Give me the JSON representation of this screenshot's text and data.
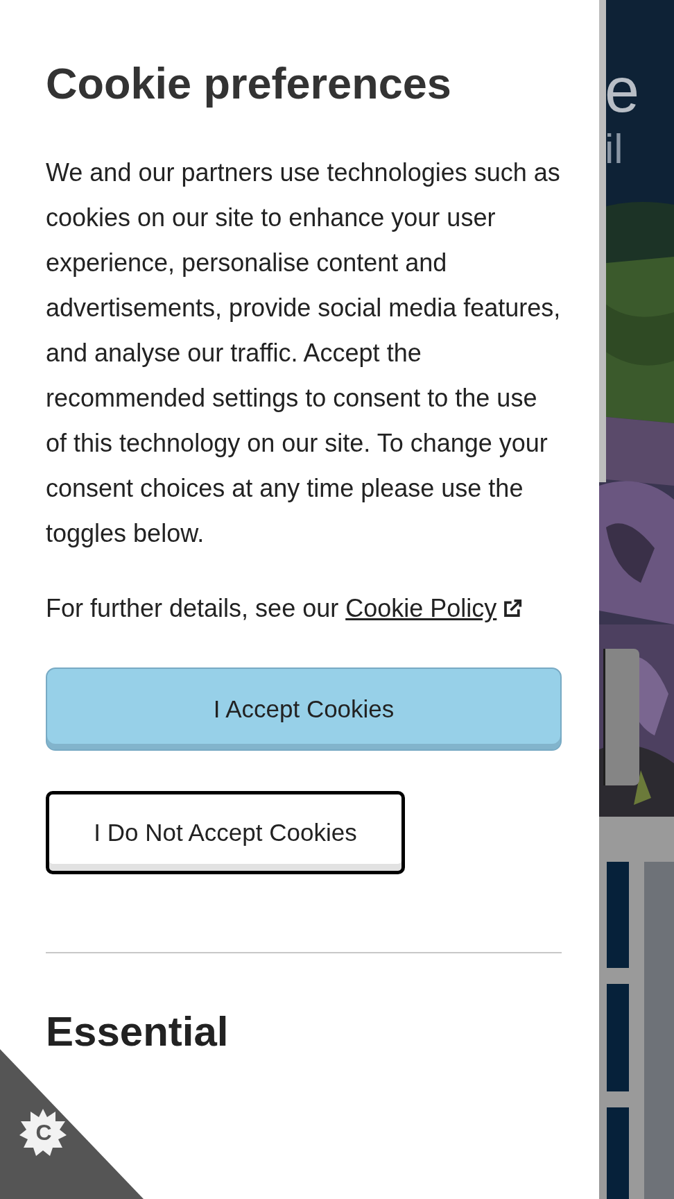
{
  "title": "Cookie preferences",
  "intro": "We and our partners use technologies such as cookies on our site to enhance your user experience, personalise content and advertisements, provide social media features, and analyse our traffic. Accept the recommended settings to consent to the use of this technology on our site. To change your consent choices at any time please use the toggles below.",
  "details": {
    "text": "For further details, see our",
    "link": "Cookie Policy"
  },
  "buttons": [
    {
      "label": "I Accept Cookies",
      "kind": "primary"
    },
    {
      "label": "I Do Not Accept Cookies",
      "kind": "secondary"
    }
  ],
  "sections": [
    {
      "title": "Essential"
    }
  ],
  "corner_badge": {
    "label": "C"
  },
  "background_page": {
    "hero_text": [
      "e",
      "il"
    ]
  }
}
